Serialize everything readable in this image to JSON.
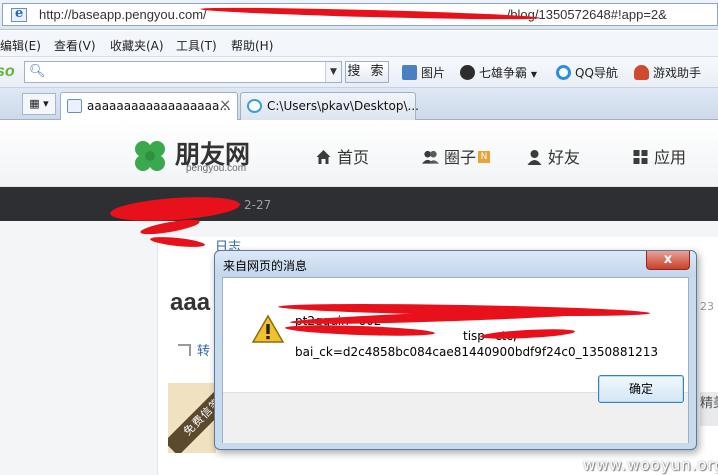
{
  "browser": {
    "url": "http://baseapp.pengyou.com/",
    "url_tail": "/blog/1350572648#!app=2&",
    "menu": [
      "编辑(E)",
      "查看(V)",
      "收藏夹(A)",
      "工具(T)",
      "帮助(H)"
    ],
    "search_button": "搜 索",
    "toolbar_items": [
      "图片",
      "七雄争霸",
      "QQ导航",
      "游戏助手"
    ],
    "tabs": [
      {
        "label": "aaaaaaaaaaaaaaaaaa...",
        "active": true
      },
      {
        "label": "C:\\Users\\pkav\\Desktop\\...",
        "active": false
      }
    ]
  },
  "site": {
    "brand": "朋友网",
    "domain": "pengyou.com",
    "nav": [
      {
        "label": "首页",
        "icon": "home-icon"
      },
      {
        "label": "圈子",
        "icon": "group-icon",
        "badge": "N"
      },
      {
        "label": "好友",
        "icon": "friend-icon"
      },
      {
        "label": "应用",
        "icon": "apps-icon"
      }
    ],
    "date": "2-27",
    "log_link": "日志",
    "post_title": "aaa",
    "forward_label": "转",
    "ribbon": "免费信笺",
    "right_time": "23",
    "right_snippet": "精美"
  },
  "dialog": {
    "title": "来自网页的消息",
    "line1": "pt2gguin=o02",
    "line2": "tisp=ctc;",
    "line3": "bai_ck=d2c4858bc084cae81440900bdf9f24c0_1350881213",
    "ok": "确定",
    "close": "x"
  },
  "watermark": "www.wooyun.org",
  "colors": {
    "redaction": "#e8101a",
    "clover": "#3aa84c",
    "dark_strip": "#2d2f33",
    "dialog_frame": "#c8dbee"
  }
}
